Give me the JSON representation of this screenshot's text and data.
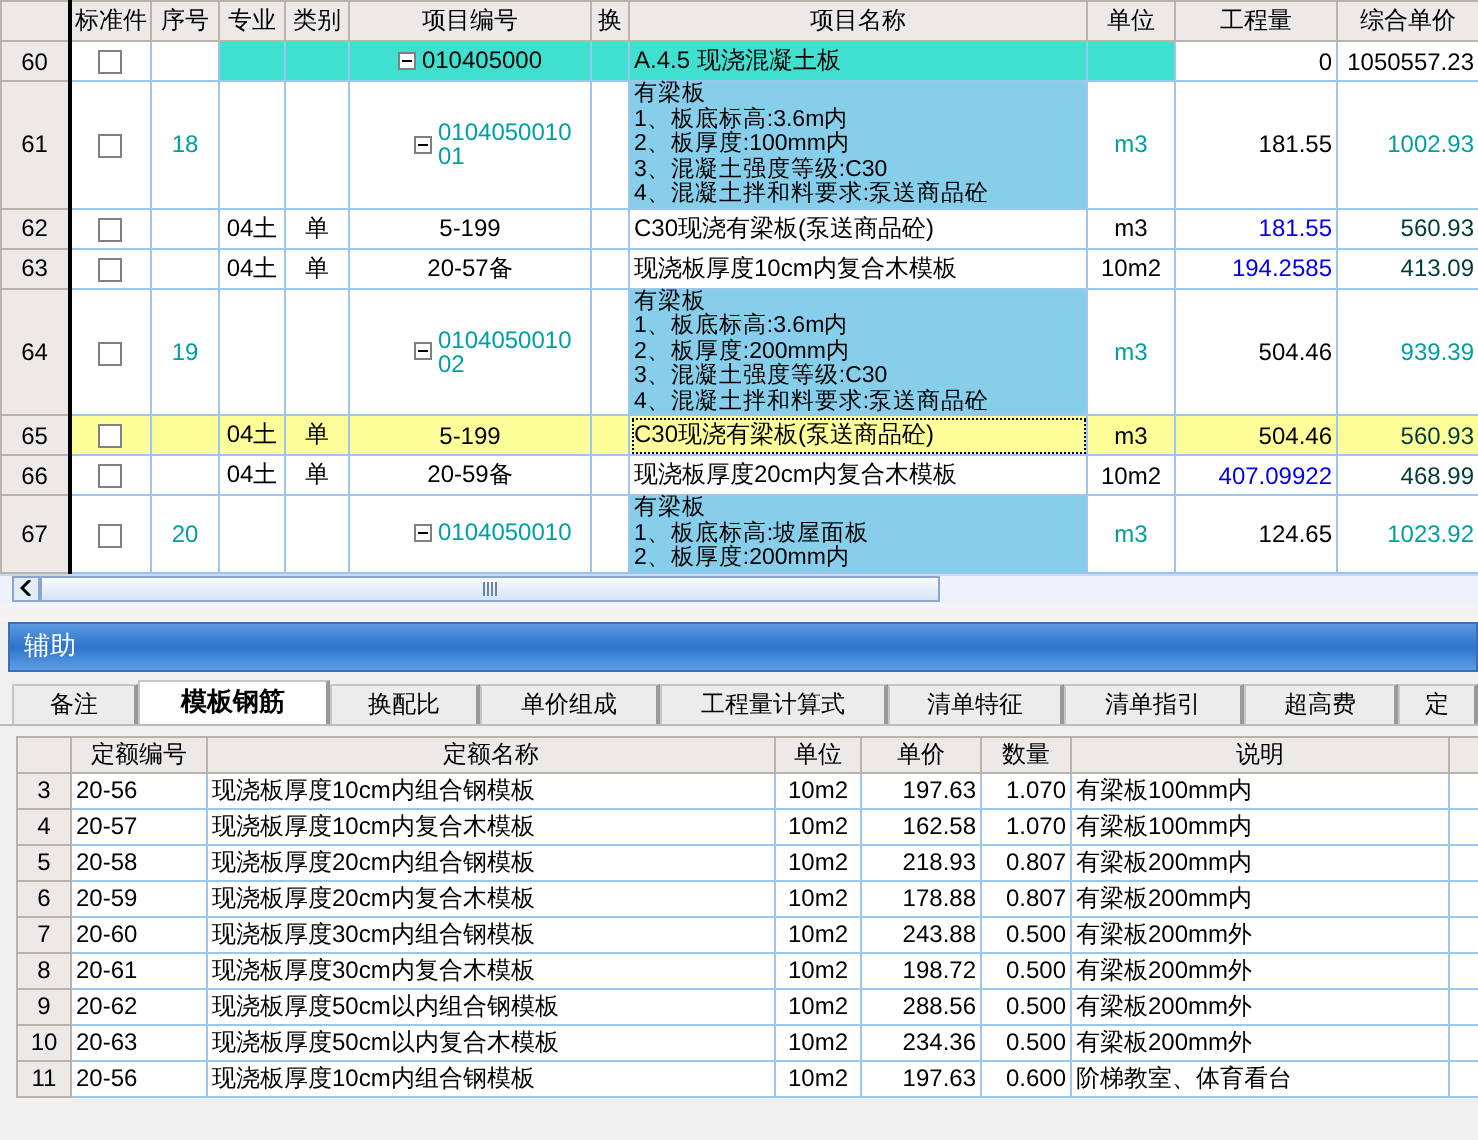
{
  "main_table": {
    "columns": [
      "标准件",
      "序号",
      "专业",
      "类别",
      "项目编号",
      "换",
      "项目名称",
      "单位",
      "工程量",
      "综合单价"
    ],
    "rows": [
      {
        "row_no": "60",
        "kind": "group",
        "checked": false,
        "selected": false,
        "expanded": true,
        "code": "010405000",
        "name": "A.4.5 现浇混凝土板",
        "quantity": "0",
        "unit_price": "1050557.23"
      },
      {
        "row_no": "61",
        "kind": "item",
        "checked": false,
        "selected": false,
        "expanded": true,
        "seq": "18",
        "code": "0104050010 01",
        "name_lines": [
          "有梁板",
          "1、板底标高:3.6m内",
          "2、板厚度:100mm内",
          "3、混凝土强度等级:C30",
          "4、混凝土拌和料要求:泵送商品砼"
        ],
        "unit": "m3",
        "quantity": "181.55",
        "unit_price": "1002.93"
      },
      {
        "row_no": "62",
        "kind": "quota",
        "checked": false,
        "selected": false,
        "linked": true,
        "specialty": "04土",
        "category": "单",
        "code": "5-199",
        "name": "C30现浇有梁板(泵送商品砼)",
        "unit": "m3",
        "quantity": "181.55",
        "unit_price": "560.93"
      },
      {
        "row_no": "63",
        "kind": "quota",
        "checked": false,
        "selected": false,
        "linked": true,
        "specialty": "04土",
        "category": "单",
        "code": "20-57备",
        "name": "现浇板厚度10cm内复合木模板",
        "unit": "10m2",
        "quantity": "194.2585",
        "unit_price": "413.09"
      },
      {
        "row_no": "64",
        "kind": "item",
        "checked": false,
        "selected": false,
        "expanded": true,
        "seq": "19",
        "code": "0104050010 02",
        "name_lines": [
          "有梁板",
          "1、板底标高:3.6m内",
          "2、板厚度:200mm内",
          "3、混凝土强度等级:C30",
          "4、混凝土拌和料要求:泵送商品砼"
        ],
        "unit": "m3",
        "quantity": "504.46",
        "unit_price": "939.39"
      },
      {
        "row_no": "65",
        "kind": "quota",
        "checked": false,
        "selected": true,
        "linked": false,
        "specialty": "04土",
        "category": "单",
        "code": "5-199",
        "name": "C30现浇有梁板(泵送商品砼)",
        "unit": "m3",
        "quantity": "504.46",
        "unit_price": "560.93"
      },
      {
        "row_no": "66",
        "kind": "quota",
        "checked": false,
        "selected": false,
        "linked": true,
        "specialty": "04土",
        "category": "单",
        "code": "20-59备",
        "name": "现浇板厚度20cm内复合木模板",
        "unit": "10m2",
        "quantity": "407.09922",
        "unit_price": "468.99"
      },
      {
        "row_no": "67",
        "kind": "item",
        "checked": false,
        "selected": false,
        "expanded": true,
        "seq": "20",
        "code": "0104050010",
        "name_lines": [
          "有梁板",
          "1、板底标高:坡屋面板",
          "2、板厚度:200mm内"
        ],
        "unit": "m3",
        "quantity": "124.65",
        "unit_price": "1023.92"
      }
    ]
  },
  "aux_panel": {
    "title": "辅助",
    "tabs": [
      {
        "label": "备注",
        "selected": false
      },
      {
        "label": "模板钢筋",
        "selected": true
      },
      {
        "label": "换配比",
        "selected": false
      },
      {
        "label": "单价组成",
        "selected": false
      },
      {
        "label": "工程量计算式",
        "selected": false
      },
      {
        "label": "清单特征",
        "selected": false
      },
      {
        "label": "清单指引",
        "selected": false
      },
      {
        "label": "超高费",
        "selected": false
      },
      {
        "label": "定",
        "selected": false
      }
    ],
    "table": {
      "columns": [
        "定额编号",
        "定额名称",
        "单位",
        "单价",
        "数量",
        "说明"
      ],
      "rows": [
        {
          "row_no": "3",
          "code": "20-56",
          "name": "现浇板厚度10cm内组合钢模板",
          "unit": "10m2",
          "price": "197.63",
          "qty": "1.070",
          "note": "有梁板100mm内"
        },
        {
          "row_no": "4",
          "code": "20-57",
          "name": "现浇板厚度10cm内复合木模板",
          "unit": "10m2",
          "price": "162.58",
          "qty": "1.070",
          "note": "有梁板100mm内"
        },
        {
          "row_no": "5",
          "code": "20-58",
          "name": "现浇板厚度20cm内组合钢模板",
          "unit": "10m2",
          "price": "218.93",
          "qty": "0.807",
          "note": "有梁板200mm内"
        },
        {
          "row_no": "6",
          "code": "20-59",
          "name": "现浇板厚度20cm内复合木模板",
          "unit": "10m2",
          "price": "178.88",
          "qty": "0.807",
          "note": "有梁板200mm内"
        },
        {
          "row_no": "7",
          "code": "20-60",
          "name": "现浇板厚度30cm内组合钢模板",
          "unit": "10m2",
          "price": "243.88",
          "qty": "0.500",
          "note": "有梁板200mm外"
        },
        {
          "row_no": "8",
          "code": "20-61",
          "name": "现浇板厚度30cm内复合木模板",
          "unit": "10m2",
          "price": "198.72",
          "qty": "0.500",
          "note": "有梁板200mm外"
        },
        {
          "row_no": "9",
          "code": "20-62",
          "name": "现浇板厚度50cm以内组合钢模板",
          "unit": "10m2",
          "price": "288.56",
          "qty": "0.500",
          "note": "有梁板200mm外"
        },
        {
          "row_no": "10",
          "code": "20-63",
          "name": "现浇板厚度50cm以内复合木模板",
          "unit": "10m2",
          "price": "234.36",
          "qty": "0.500",
          "note": "有梁板200mm外"
        },
        {
          "row_no": "11",
          "code": "20-56",
          "name": "现浇板厚度10cm内组合钢模板",
          "unit": "10m2",
          "price": "197.63",
          "qty": "0.600",
          "note": "阶梯教室、体育看台"
        }
      ]
    }
  }
}
